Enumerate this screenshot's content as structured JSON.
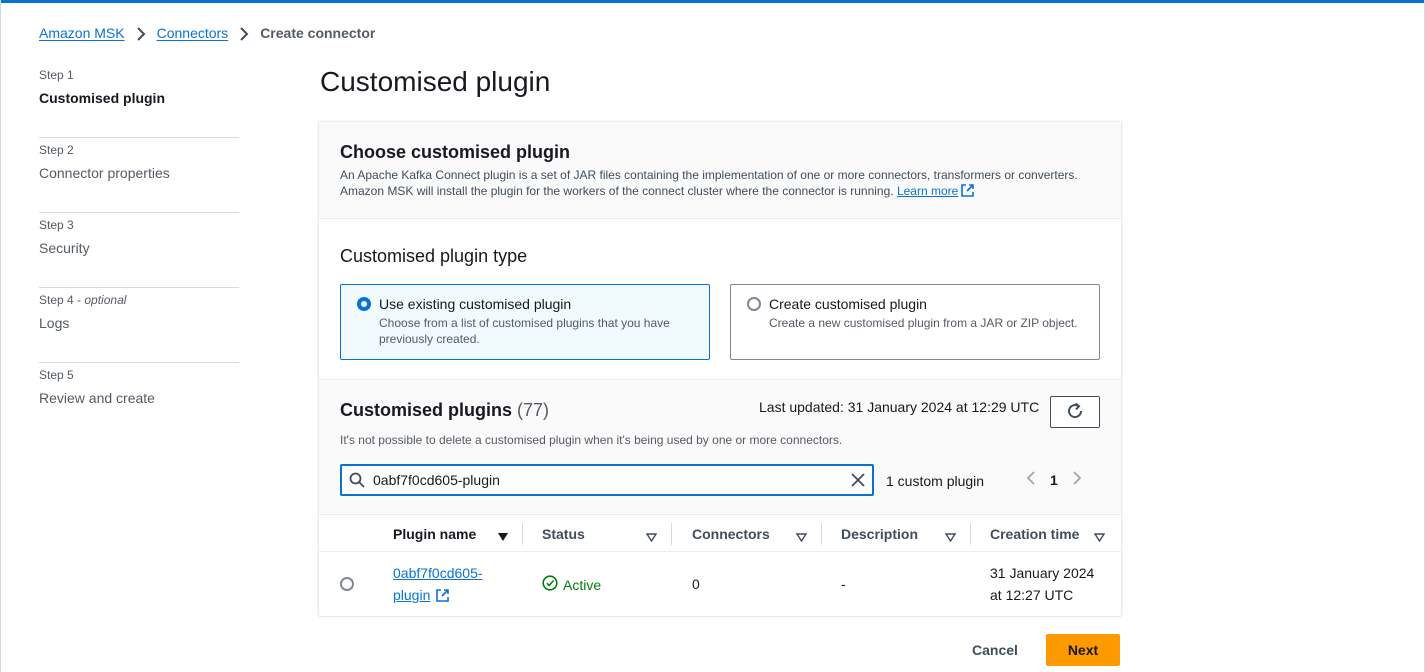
{
  "breadcrumb": {
    "items": [
      "Amazon MSK",
      "Connectors"
    ],
    "current": "Create connector"
  },
  "steps": [
    {
      "num": "Step 1",
      "title": "Customised plugin",
      "active": true
    },
    {
      "num": "Step 2",
      "title": "Connector properties"
    },
    {
      "num": "Step 3",
      "title": "Security"
    },
    {
      "num": "Step 4",
      "optional": "optional",
      "title": "Logs"
    },
    {
      "num": "Step 5",
      "title": "Review and create"
    }
  ],
  "page_title": "Customised plugin",
  "choose": {
    "title": "Choose customised plugin",
    "description": "An Apache Kafka Connect plugin is a set of JAR files containing the implementation of one or more connectors, transformers or converters. Amazon MSK will install the plugin for the workers of the connect cluster where the connector is running.",
    "learn_more": "Learn more"
  },
  "plugin_type": {
    "label": "Customised plugin type",
    "options": [
      {
        "label": "Use existing customised plugin",
        "description": "Choose from a list of customised plugins that you have previously created.",
        "selected": true
      },
      {
        "label": "Create customised plugin",
        "description": "Create a new customised plugin from a JAR or ZIP object.",
        "selected": false
      }
    ]
  },
  "plugins_table": {
    "title": "Customised plugins",
    "count": "(77)",
    "last_updated": "Last updated: 31 January 2024 at 12:29 UTC",
    "description": "It's not possible to delete a customised plugin when it's being used by one or more connectors.",
    "search_value": "0abf7f0cd605-plugin",
    "match_count": "1 custom plugin",
    "page": "1",
    "columns": [
      "Plugin name",
      "Status",
      "Connectors",
      "Description",
      "Creation time"
    ],
    "rows": [
      {
        "name_line1": "0abf7f0cd605-",
        "name_line2": "plugin",
        "status": "Active",
        "connectors": "0",
        "description": "-",
        "created_line1": "31 January 2024",
        "created_line2": "at 12:27 UTC"
      }
    ]
  },
  "actions": {
    "cancel": "Cancel",
    "next": "Next"
  },
  "colors": {
    "link": "#0972d3",
    "primary_button": "#ff9900",
    "success": "#037f0c"
  }
}
